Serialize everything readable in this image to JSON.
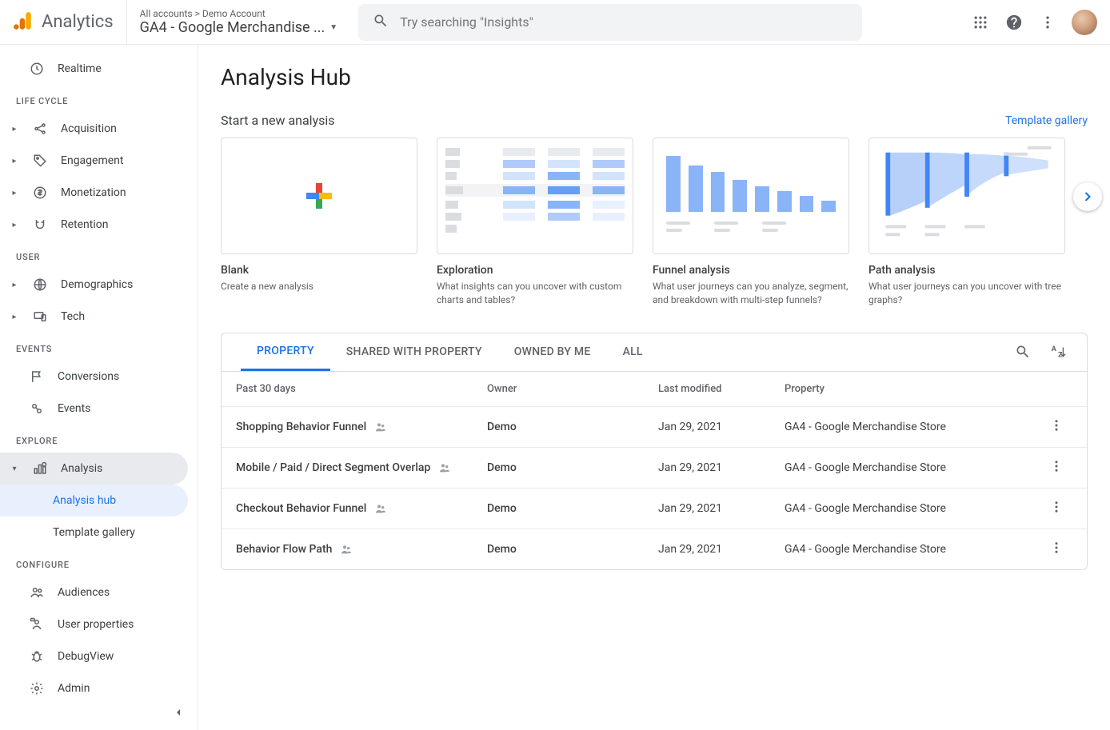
{
  "app_name": "Analytics",
  "breadcrumb": "All accounts > Demo Account",
  "property": "GA4 - Google Merchandise ...",
  "search_placeholder": "Try searching \"Insights\"",
  "sidebar": {
    "realtime": "Realtime",
    "sections": {
      "life_cycle": "LIFE CYCLE",
      "user": "USER",
      "events": "EVENTS",
      "explore": "EXPLORE",
      "configure": "CONFIGURE"
    },
    "items": {
      "acquisition": "Acquisition",
      "engagement": "Engagement",
      "monetization": "Monetization",
      "retention": "Retention",
      "demographics": "Demographics",
      "tech": "Tech",
      "conversions": "Conversions",
      "events_item": "Events",
      "analysis": "Analysis",
      "analysis_hub": "Analysis hub",
      "template_gallery": "Template gallery",
      "audiences": "Audiences",
      "user_properties": "User properties",
      "debugview": "DebugView",
      "admin": "Admin"
    }
  },
  "page_title": "Analysis Hub",
  "start_label": "Start a new analysis",
  "gallery_link": "Template gallery",
  "templates": [
    {
      "title": "Blank",
      "desc": "Create a new analysis"
    },
    {
      "title": "Exploration",
      "desc": "What insights can you uncover with custom charts and tables?"
    },
    {
      "title": "Funnel analysis",
      "desc": "What user journeys can you analyze, segment, and breakdown with multi-step funnels?"
    },
    {
      "title": "Path analysis",
      "desc": "What user journeys can you uncover with tree graphs?"
    }
  ],
  "tabs": [
    "PROPERTY",
    "SHARED WITH PROPERTY",
    "OWNED BY ME",
    "ALL"
  ],
  "table": {
    "headers": {
      "name": "Past 30 days",
      "owner": "Owner",
      "modified": "Last modified",
      "property": "Property"
    },
    "rows": [
      {
        "name": "Shopping Behavior Funnel",
        "owner": "Demo",
        "modified": "Jan 29, 2021",
        "property": "GA4 - Google Merchandise Store"
      },
      {
        "name": "Mobile / Paid / Direct Segment Overlap",
        "owner": "Demo",
        "modified": "Jan 29, 2021",
        "property": "GA4 - Google Merchandise Store"
      },
      {
        "name": "Checkout Behavior Funnel",
        "owner": "Demo",
        "modified": "Jan 29, 2021",
        "property": "GA4 - Google Merchandise Store"
      },
      {
        "name": "Behavior Flow Path",
        "owner": "Demo",
        "modified": "Jan 29, 2021",
        "property": "GA4 - Google Merchandise Store"
      }
    ]
  }
}
